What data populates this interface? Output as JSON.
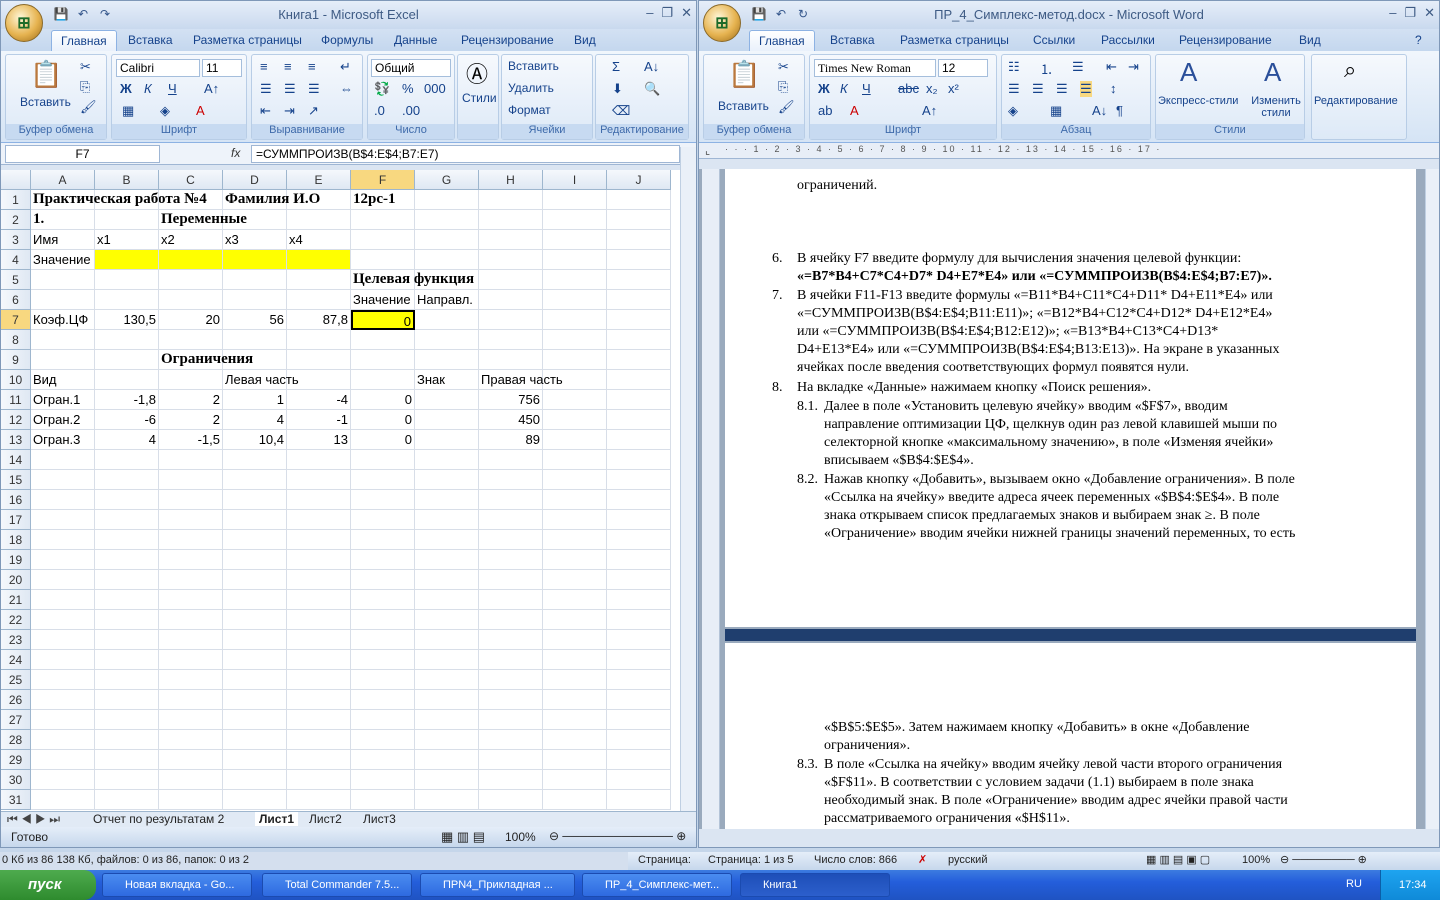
{
  "excel": {
    "title": "Книга1 - Microsoft Excel",
    "tabs": [
      "Главная",
      "Вставка",
      "Разметка страницы",
      "Формулы",
      "Данные",
      "Рецензирование",
      "Вид"
    ],
    "groups": {
      "clipboard": "Буфер обмена",
      "font": "Шрифт",
      "align": "Выравнивание",
      "number": "Число",
      "cells": "Ячейки",
      "edit": "Редактирование"
    },
    "paste": "Вставить",
    "font_name": "Calibri",
    "font_size": "11",
    "number_format": "Общий",
    "styles": "Стили",
    "insert": "Вставить",
    "delete": "Удалить",
    "format": "Формат",
    "namebox": "F7",
    "fx": "fx",
    "formula": "=СУММПРОИЗВ(B$4:E$4;B7:E7)",
    "columns": [
      "A",
      "B",
      "C",
      "D",
      "E",
      "F",
      "G",
      "H",
      "I",
      "J"
    ],
    "rows": [
      "1",
      "2",
      "3",
      "4",
      "5",
      "6",
      "7",
      "8",
      "9",
      "10",
      "11",
      "12",
      "13",
      "14",
      "15",
      "16",
      "17",
      "18",
      "19",
      "20",
      "21",
      "22",
      "23",
      "24",
      "25",
      "26",
      "27",
      "28",
      "29",
      "30",
      "31"
    ],
    "cells": {
      "A1": "Практическая работа №4",
      "D1": "Фамилия И.О",
      "F1": "12рс-1",
      "A2": "1.",
      "C2": "Переменные",
      "A3": "Имя",
      "B3": "x1",
      "C3": "x2",
      "D3": "x3",
      "E3": "x4",
      "A4": "Значение",
      "F5": "Целевая функция",
      "F6": "Значение",
      "G6": "Направл.",
      "A7": "Коэф.ЦФ",
      "B7": "130,5",
      "C7": "20",
      "D7": "56",
      "E7": "87,8",
      "F7": "0",
      "C9": "Ограничения",
      "A10": "Вид",
      "D10": "Левая часть",
      "G10": "Знак",
      "H10": "Правая часть",
      "A11": "Огран.1",
      "B11": "-1,8",
      "C11": "2",
      "D11": "1",
      "E11": "-4",
      "F11": "0",
      "H11": "756",
      "A12": "Огран.2",
      "B12": "-6",
      "C12": "2",
      "D12": "4",
      "E12": "-1",
      "F12": "0",
      "H12": "450",
      "A13": "Огран.3",
      "B13": "4",
      "C13": "-1,5",
      "D13": "10,4",
      "E13": "13",
      "F13": "0",
      "H13": "89"
    },
    "sheet_tabs": [
      "Отчет по результатам 2",
      "Лист1",
      "Лист2",
      "Лист3"
    ],
    "status": "Готово",
    "zoom": "100%"
  },
  "word": {
    "title": "ПР_4_Симплекс-метод.docx - Microsoft Word",
    "tabs": [
      "Главная",
      "Вставка",
      "Разметка страницы",
      "Ссылки",
      "Рассылки",
      "Рецензирование",
      "Вид"
    ],
    "groups": {
      "clipboard": "Буфер обмена",
      "font": "Шрифт",
      "para": "Абзац",
      "styles": "Стили"
    },
    "paste": "Вставить",
    "font_name": "Times New Roman",
    "font_size": "12",
    "express": "Экспресс-стили",
    "change": "Изменить стили",
    "editing": "Редактирование",
    "top_line": "ограничений.",
    "p6_num": "6.",
    "p6": "В ячейку F7 введите формулу для вычисления значения целевой функции:",
    "p6b": "«=B7*B4+C7*C4+D7* D4+E7*E4» или «=СУММПРОИЗВ(B$4:E$4;B7:E7)».",
    "p7_num": "7.",
    "p7_l1": "В ячейки F11-F13 введите формулы «=B11*B4+C11*C4+D11* D4+E11*E4» или",
    "p7_l2": "«=СУММПРОИЗВ(B$4:E$4;B11:E11)»; «=B12*B4+C12*C4+D12* D4+E12*E4»",
    "p7_l3": "или «=СУММПРОИЗВ(B$4:E$4;B12:E12)»; «=B13*B4+C13*C4+D13*",
    "p7_l4": "D4+E13*E4» или «=СУММПРОИЗВ(B$4:E$4;B13:E13)». На экране в указанных",
    "p7_l5": "ячейках после введения соответствующих формул появятся нули.",
    "p8_num": "8.",
    "p8": "На вкладке «Данные» нажимаем кнопку «Поиск решения».",
    "p81_num": "8.1.",
    "p81_l1": "Далее в поле «Установить целевую ячейку» вводим «$F$7», вводим",
    "p81_l2": "направление оптимизации ЦФ, щелкнув один раз левой клавишей мыши по",
    "p81_l3": "селекторной кнопке «максимальному значению», в поле «Изменяя ячейки»",
    "p81_l4": "вписываем «$B$4:$E$4».",
    "p82_num": "8.2.",
    "p82_l1": "Нажав кнопку «Добавить», вызываем окно «Добавление ограничения». В поле",
    "p82_l2": "«Ссылка на ячейку» введите адреса ячеек переменных «$B$4:$E$4». В поле",
    "p82_l3": "знака открываем список предлагаемых знаков и выбираем знак ≥. В поле",
    "p82_l4": "«Ограничение» вводим ячейки нижней границы значений переменных, то есть",
    "pg2_l1": "«$B$5:$E$5». Затем нажимаем кнопку «Добавить» в окне «Добавление",
    "pg2_l2": "ограничения».",
    "p83_num": "8.3.",
    "p83_l1": "В поле «Ссылка на ячейку» вводим ячейку левой части второго ограничения",
    "p83_l2": "«$F$11». В соответствии с условием задачи (1.1) выбираем в поле знака",
    "p83_l3": "необходимый знак. В поле «Ограничение» вводим адрес ячейки правой части",
    "p83_l4": "рассматриваемого ограничения «$H$11».",
    "status_page_label": "Страница:",
    "status_page": "Страница: 1 из 5",
    "status_words": "Число слов: 866",
    "status_lang": "русский",
    "zoom": "100%"
  },
  "infobar": "0 Кб из 86 138 Кб, файлов: 0 из 86, папок: 0 из 2",
  "taskbar": {
    "start": "пуск",
    "items": [
      "Новая вкладка - Go...",
      "Total Commander 7.5...",
      "ПРN4_Прикладная ...",
      "ПР_4_Симплекс-мет...",
      "Книга1"
    ],
    "lang": "RU",
    "time": "17:34"
  }
}
